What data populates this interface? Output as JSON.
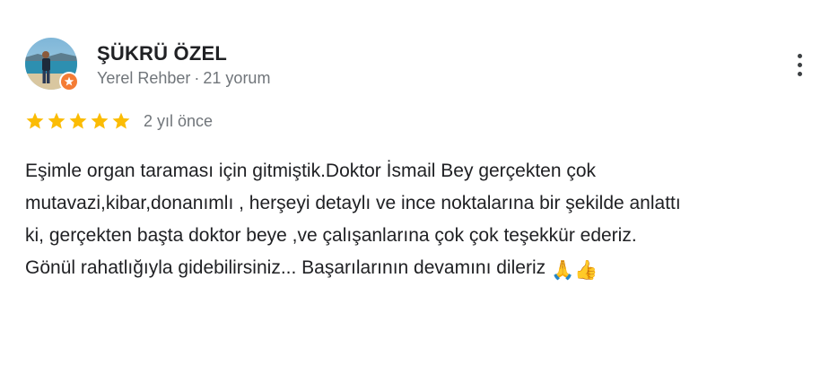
{
  "review": {
    "author": {
      "name": "ŞÜKRÜ ÖZEL",
      "role": "Yerel Rehber",
      "separator": "·",
      "review_count": "21 yorum",
      "avatar_icon": "profile-photo-beach",
      "badge_icon": "local-guide-star-icon"
    },
    "more_button_icon": "more-vert-icon",
    "rating": {
      "stars": 5,
      "max_stars": 5,
      "star_color": "#fbbc04",
      "date": "2 yıl önce"
    },
    "text_lines": [
      "Eşimle organ taraması için gitmiştik.Doktor İsmail Bey gerçekten çok",
      "mutavazi,kibar,donanımlı , herşeyi detaylı ve ince noktalarına bir şekilde anlattı",
      "ki, gerçekten başta doktor beye ,ve çalışanlarına çok çok teşekkür ederiz.",
      "Gönül rahatlığıyla gidebilirsiniz... Başarılarının devamını dileriz "
    ],
    "emojis": [
      "🙏",
      "👍"
    ],
    "colors": {
      "text": "#202124",
      "secondary": "#70757a",
      "badge": "#f47c35"
    }
  }
}
